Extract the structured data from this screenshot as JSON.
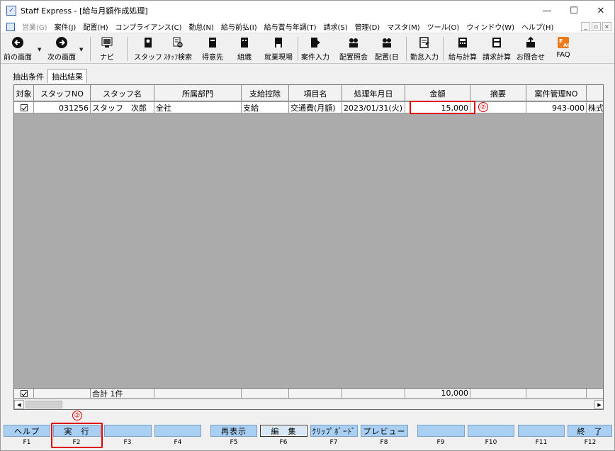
{
  "window": {
    "title": "Staff Express - [給与月額作成処理]",
    "icon_name": "app-icon",
    "controls": [
      "—",
      "☐",
      "✕"
    ]
  },
  "menubar": {
    "items": [
      {
        "label": "営業(G)",
        "disabled": true
      },
      {
        "label": "案件(J)"
      },
      {
        "label": "配置(H)"
      },
      {
        "label": "コンプライアンス(C)"
      },
      {
        "label": "勤怠(N)"
      },
      {
        "label": "給与前払(I)"
      },
      {
        "label": "給与賞与年調(T)"
      },
      {
        "label": "請求(S)"
      },
      {
        "label": "管理(D)"
      },
      {
        "label": "マスタ(M)"
      },
      {
        "label": "ツール(O)"
      },
      {
        "label": "ウィンドウ(W)"
      },
      {
        "label": "ヘルプ(H)"
      }
    ],
    "mdi_controls": [
      "_",
      "▫",
      "×"
    ]
  },
  "toolbar": {
    "buttons": [
      {
        "label": "前の画面",
        "icon": "back-arrow-icon"
      },
      {
        "label": "次の画面",
        "icon": "forward-arrow-icon"
      },
      {
        "label": "ナビ",
        "icon": "navi-icon"
      },
      {
        "label": "スタッフ",
        "icon": "staff-icon"
      },
      {
        "label": "ｽﾀｯﾌ検索",
        "icon": "staff-search-icon"
      },
      {
        "label": "得意先",
        "icon": "customer-icon"
      },
      {
        "label": "組織",
        "icon": "organization-icon"
      },
      {
        "label": "就業現場",
        "icon": "worksite-icon"
      },
      {
        "label": "案件入力",
        "icon": "case-input-icon"
      },
      {
        "label": "配置照会",
        "icon": "placement-inquiry-icon"
      },
      {
        "label": "配置(日",
        "icon": "placement-daily-icon"
      },
      {
        "label": "勤怠入力",
        "icon": "attendance-input-icon"
      },
      {
        "label": "給与計算",
        "icon": "payroll-calc-icon"
      },
      {
        "label": "請求計算",
        "icon": "billing-calc-icon"
      },
      {
        "label": "お問合せ",
        "icon": "inquiry-icon"
      },
      {
        "label": "FAQ",
        "icon": "faq-icon"
      }
    ]
  },
  "tabs": [
    {
      "label": "抽出条件"
    },
    {
      "label": "抽出結果",
      "active": true
    }
  ],
  "grid": {
    "columns": [
      "対象",
      "スタッフNO",
      "スタッフ名",
      "所属部門",
      "支給控除",
      "項目名",
      "処理年月日",
      "金額",
      "摘要",
      "案件管理NO",
      ""
    ],
    "rows": [
      {
        "checked": true,
        "staff_no": "031256",
        "staff_name": "スタッフ　次郎",
        "department": "全社",
        "pay_deduct": "支給",
        "item_name": "交通費(月額)",
        "process_date": "2023/01/31(火)",
        "amount": "15,000",
        "summary": "",
        "case_no": "943-000",
        "extra": "株式"
      }
    ],
    "footer": {
      "checked": true,
      "total_label": "合計 1件",
      "total_amount": "10,000"
    }
  },
  "annotations": {
    "marker_1": "②",
    "marker_2": "②",
    "color": "#e00000"
  },
  "function_keys": [
    {
      "label": "ヘルプ",
      "key": "F1"
    },
    {
      "label": "実　行",
      "key": "F2"
    },
    {
      "label": "",
      "key": "F3"
    },
    {
      "label": "",
      "key": "F4"
    },
    {
      "label": "再表示",
      "key": "F5"
    },
    {
      "label": "編　集",
      "key": "F6"
    },
    {
      "label": "ｸﾘｯﾌﾟﾎﾞｰﾄﾞ",
      "key": "F7"
    },
    {
      "label": "プレビュー",
      "key": "F8"
    },
    {
      "label": "",
      "key": "F9"
    },
    {
      "label": "",
      "key": "F10"
    },
    {
      "label": "",
      "key": "F11"
    },
    {
      "label": "終　了",
      "key": "F12"
    }
  ]
}
